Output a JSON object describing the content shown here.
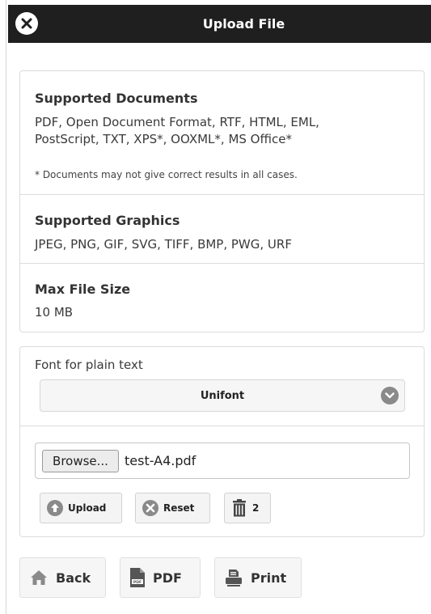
{
  "header": {
    "title": "Upload File"
  },
  "info": {
    "documents": {
      "heading": "Supported Documents",
      "line1": "PDF, Open Document Format, RTF, HTML, EML,",
      "line2": "PostScript, TXT, XPS*, OOXML*, MS Office*",
      "note": "* Documents may not give correct results in all cases."
    },
    "graphics": {
      "heading": "Supported Graphics",
      "list": "JPEG, PNG, GIF, SVG, TIFF, BMP, PWG, URF"
    },
    "maxsize": {
      "heading": "Max File Size",
      "value": "10 MB"
    }
  },
  "font": {
    "label": "Font for plain text",
    "selected": "Unifont"
  },
  "file": {
    "browse_label": "Browse...",
    "filename": "test-A4.pdf"
  },
  "actions": {
    "upload_label": "Upload",
    "reset_label": "Reset",
    "delete_count": "2"
  },
  "footer": {
    "back_label": "Back",
    "pdf_label": "PDF",
    "print_label": "Print"
  },
  "colors": {
    "header_bg": "#1f1f1f",
    "icon_gray": "#8a8a8a"
  }
}
